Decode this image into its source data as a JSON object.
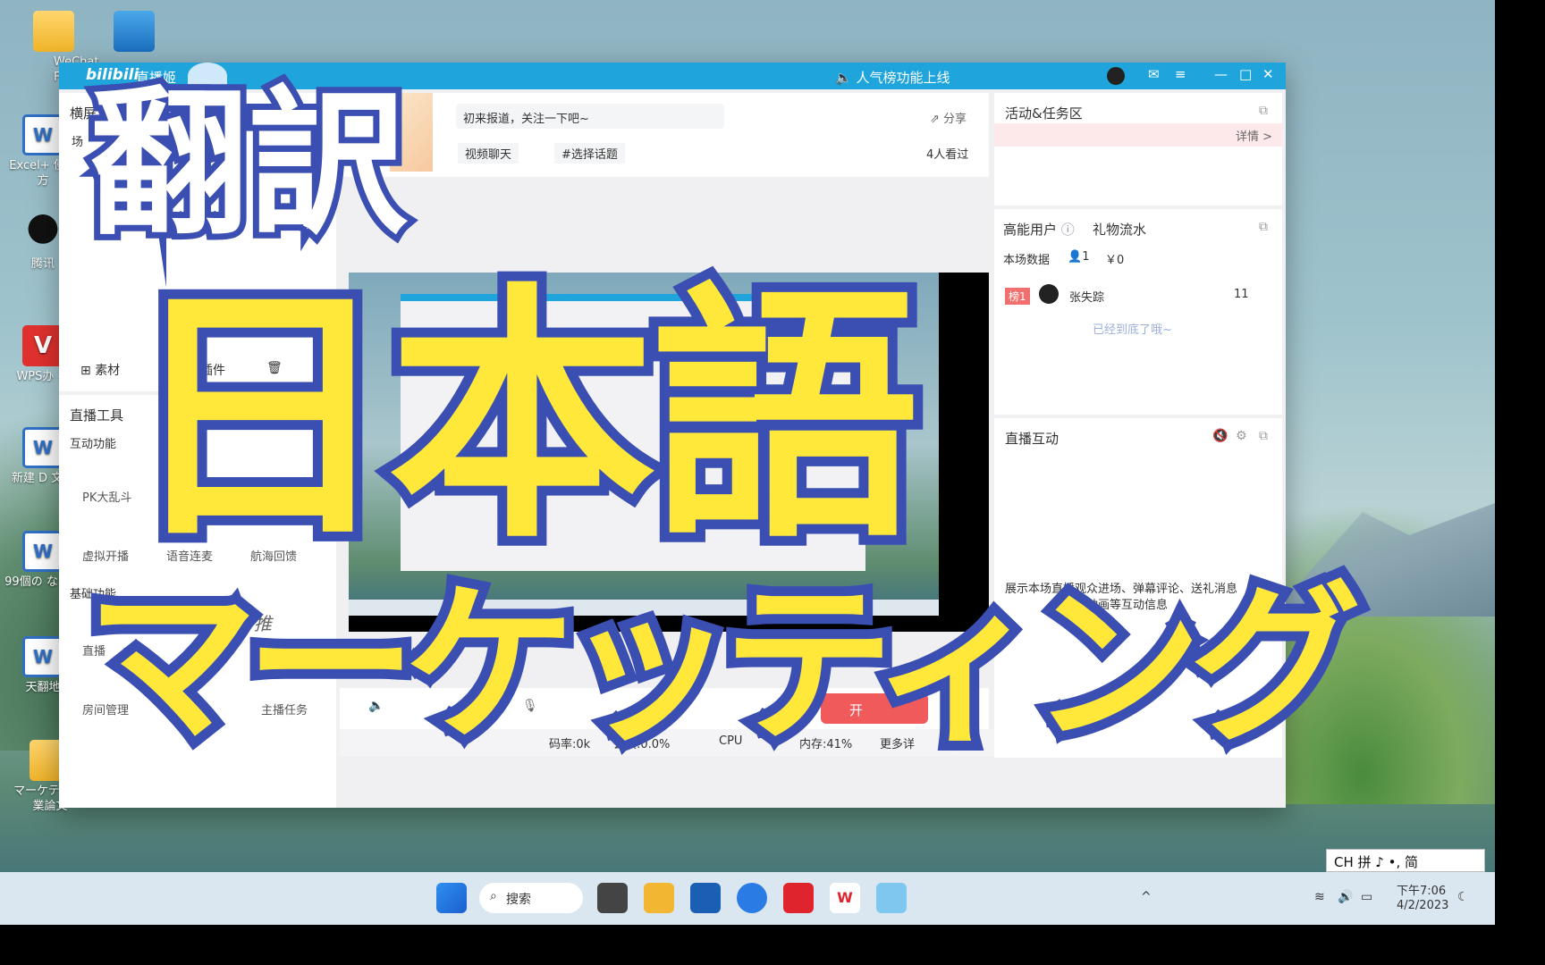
{
  "desktop": {
    "icons": [
      {
        "label": "WeChat Files",
        "kind": "folder"
      },
      {
        "label": "",
        "kind": "shortcut-folder"
      },
      {
        "label": "Excel+ 使用方",
        "kind": "word"
      },
      {
        "label": "腾讯",
        "kind": "qq"
      },
      {
        "label": "WPS办 手",
        "kind": "wps"
      },
      {
        "label": "新建 D 文档",
        "kind": "word"
      },
      {
        "label": "99個の な心理",
        "kind": "word"
      },
      {
        "label": "天翻地",
        "kind": "word"
      },
      {
        "label": "マーケテ グ卒業論文",
        "kind": "folder"
      }
    ]
  },
  "window": {
    "app_name": "直播姬",
    "logo_text": "bilibili",
    "notice": "人气榜功能上线",
    "controls": {
      "mail": "✉",
      "menu": "≡",
      "min": "—",
      "max": "□",
      "close": "✕"
    }
  },
  "left_panel": {
    "tab_label": "横屏",
    "scene_label": "场",
    "material_btn": "素材",
    "plugin_btn": "插件",
    "tools_title": "直播工具",
    "interactive_title": "互动功能",
    "tools": [
      {
        "label": "PK大乱斗",
        "icon": "pk-icon"
      },
      {
        "label": "虚拟开播",
        "icon": "avatar-icon"
      },
      {
        "label": "语音连麦",
        "icon": "voice-icon"
      },
      {
        "label": "航海回馈",
        "icon": "ship-icon"
      }
    ],
    "basic_title": "基础功能",
    "basic_tools": [
      {
        "label": "直播",
        "icon": "gear-icon"
      },
      {
        "label": "推",
        "icon": "push-icon"
      },
      {
        "label": "房间管理",
        "icon": "room-icon"
      },
      {
        "label": "主播任务",
        "icon": "task-icon"
      }
    ]
  },
  "stream_info": {
    "title_placeholder": "初来报道，关注一下吧~",
    "share": "分享",
    "tag1": "视频聊天",
    "tag2": "#选择话题",
    "viewers": "4人看过"
  },
  "bottom_bar": {
    "start_btn": "开",
    "bitrate": "码率:0k",
    "packet_loss": "丢帧:0.0%",
    "cpu": "CPU",
    "memory": "内存:41%",
    "more": "更多详"
  },
  "right_panel": {
    "activity_title": "活动&任务区",
    "details": "详情 >",
    "high_energy_tab": "高能用户",
    "gift_tab": "礼物流水",
    "stats_label": "本场数据",
    "user_count": "1",
    "money": "￥0",
    "rank_badge": "榜1",
    "user_name": "张失踪",
    "user_score": "11",
    "bottom_hint": "已经到底了哦~",
    "interaction_title": "直播互动",
    "interaction_hint_1": "展示本场直播观众进场、弹幕评论、送礼消息",
    "interaction_hint_2": "及动画等互动信息"
  },
  "overlay": {
    "top": "翻訳",
    "middle": "日本語",
    "bottom": "マーケッティング"
  },
  "taskbar": {
    "search": "搜索",
    "ime": "CH 拼 ♪ •, 简",
    "time": "下午7:06",
    "date": "4/2/2023"
  },
  "colors": {
    "titlebar": "#1fa4dc",
    "overlay_yellow": "#ffe83a",
    "overlay_blue": "#3b4fb2",
    "start_button": "#f05a5a"
  }
}
